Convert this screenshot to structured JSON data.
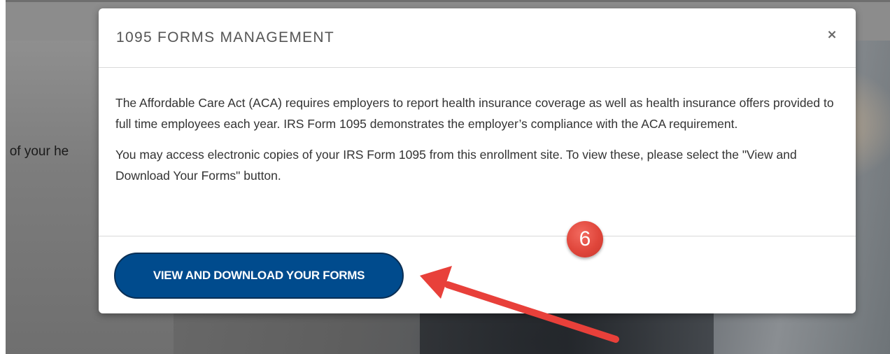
{
  "background": {
    "partial_text": "ll of your he"
  },
  "modal": {
    "title": "1095 FORMS MANAGEMENT",
    "close_label": "×",
    "body_paragraphs": [
      "The Affordable Care Act (ACA) requires employers to report health insurance coverage as well as health insurance offers provided to full time employees each year. IRS Form 1095 demonstrates the employer’s compliance with the ACA requirement.",
      "You may access electronic copies of your IRS Form 1095 from this enrollment site. To view these, please select the \"View and Download Your Forms\" button."
    ],
    "primary_button_label": "VIEW AND DOWNLOAD YOUR FORMS"
  },
  "annotation": {
    "step_number": "6",
    "badge_color": "#e0463b",
    "arrow_color": "#e8403a"
  },
  "colors": {
    "primary_button": "#004b8d",
    "title_text": "#555555",
    "body_text": "#333333"
  }
}
